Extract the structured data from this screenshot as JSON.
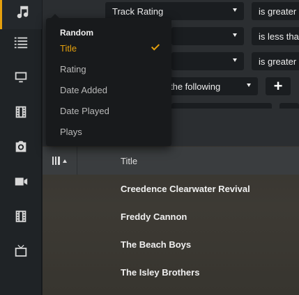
{
  "sidebar": {
    "items": [
      {
        "icon": "music-note-icon",
        "active": true
      },
      {
        "icon": "list-icon"
      },
      {
        "icon": "monitor-icon"
      },
      {
        "icon": "film-strip-icon"
      },
      {
        "icon": "camera-icon"
      },
      {
        "icon": "video-camera-icon"
      },
      {
        "icon": "film-strip-icon"
      },
      {
        "icon": "tv-icon"
      }
    ]
  },
  "filters": {
    "field1": "Track Rating",
    "op1": "is greater",
    "op2": "is less tha",
    "op3": "is greater",
    "match_text": "the following",
    "add_label": "+"
  },
  "sort_menu": {
    "heading": "Random",
    "items": [
      "Title",
      "Rating",
      "Date Added",
      "Date Played",
      "Plays"
    ],
    "selected_index": 0
  },
  "table": {
    "column_title": "Title",
    "rows": [
      "Creedence Clearwater Revival",
      "Freddy Cannon",
      "The Beach Boys",
      "The Isley Brothers"
    ]
  },
  "colors": {
    "accent": "#e5a00d",
    "sidebar_bg": "#1f2326",
    "menu_bg": "#181a1c"
  }
}
